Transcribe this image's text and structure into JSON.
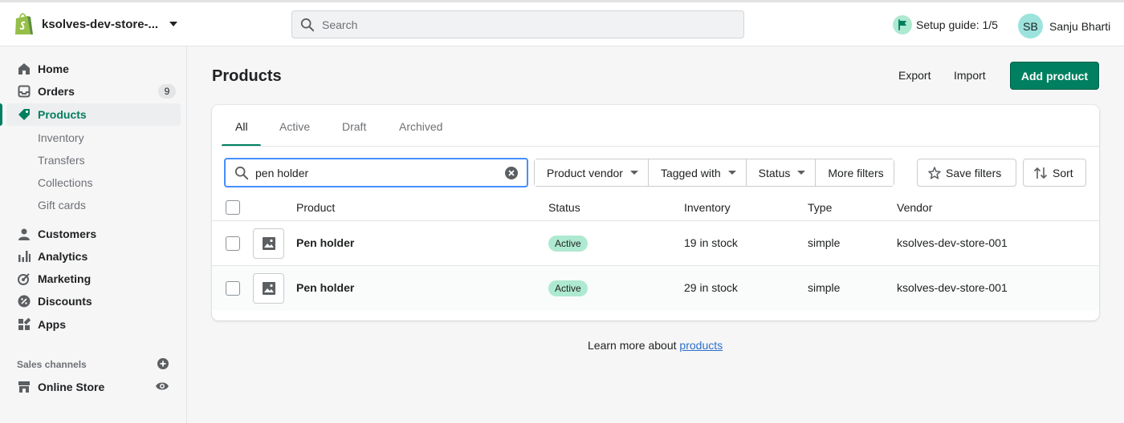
{
  "topbar": {
    "store_name": "ksolves-dev-store-...",
    "search_placeholder": "Search",
    "setup_guide": "Setup guide: 1/5",
    "user_initials": "SB",
    "user_name": "Sanju Bharti"
  },
  "sidebar": {
    "items": [
      {
        "label": "Home"
      },
      {
        "label": "Orders",
        "badge": "9"
      },
      {
        "label": "Products"
      },
      {
        "label": "Customers"
      },
      {
        "label": "Analytics"
      },
      {
        "label": "Marketing"
      },
      {
        "label": "Discounts"
      },
      {
        "label": "Apps"
      }
    ],
    "product_subitems": [
      "Inventory",
      "Transfers",
      "Collections",
      "Gift cards"
    ],
    "sales_channels_title": "Sales channels",
    "online_store": "Online Store"
  },
  "main": {
    "title": "Products",
    "export_label": "Export",
    "import_label": "Import",
    "add_product_label": "Add product",
    "tabs": [
      "All",
      "Active",
      "Draft",
      "Archived"
    ],
    "active_tab": "All",
    "filter_search_value": "pen holder",
    "filters": [
      "Product vendor",
      "Tagged with",
      "Status",
      "More filters"
    ],
    "save_filters_label": "Save filters",
    "sort_label": "Sort",
    "columns": [
      "Product",
      "Status",
      "Inventory",
      "Type",
      "Vendor"
    ],
    "rows": [
      {
        "name": "Pen holder",
        "status": "Active",
        "inventory": "19 in stock",
        "type": "simple",
        "vendor": "ksolves-dev-store-001"
      },
      {
        "name": "Pen holder",
        "status": "Active",
        "inventory": "29 in stock",
        "type": "simple",
        "vendor": "ksolves-dev-store-001"
      }
    ],
    "learn_more_text": "Learn more about",
    "learn_more_link": "products"
  },
  "colors": {
    "brand_green": "#008060",
    "active_badge": "#aee9d1",
    "focus_blue": "#458fff",
    "link_blue": "#2c6ecb"
  }
}
